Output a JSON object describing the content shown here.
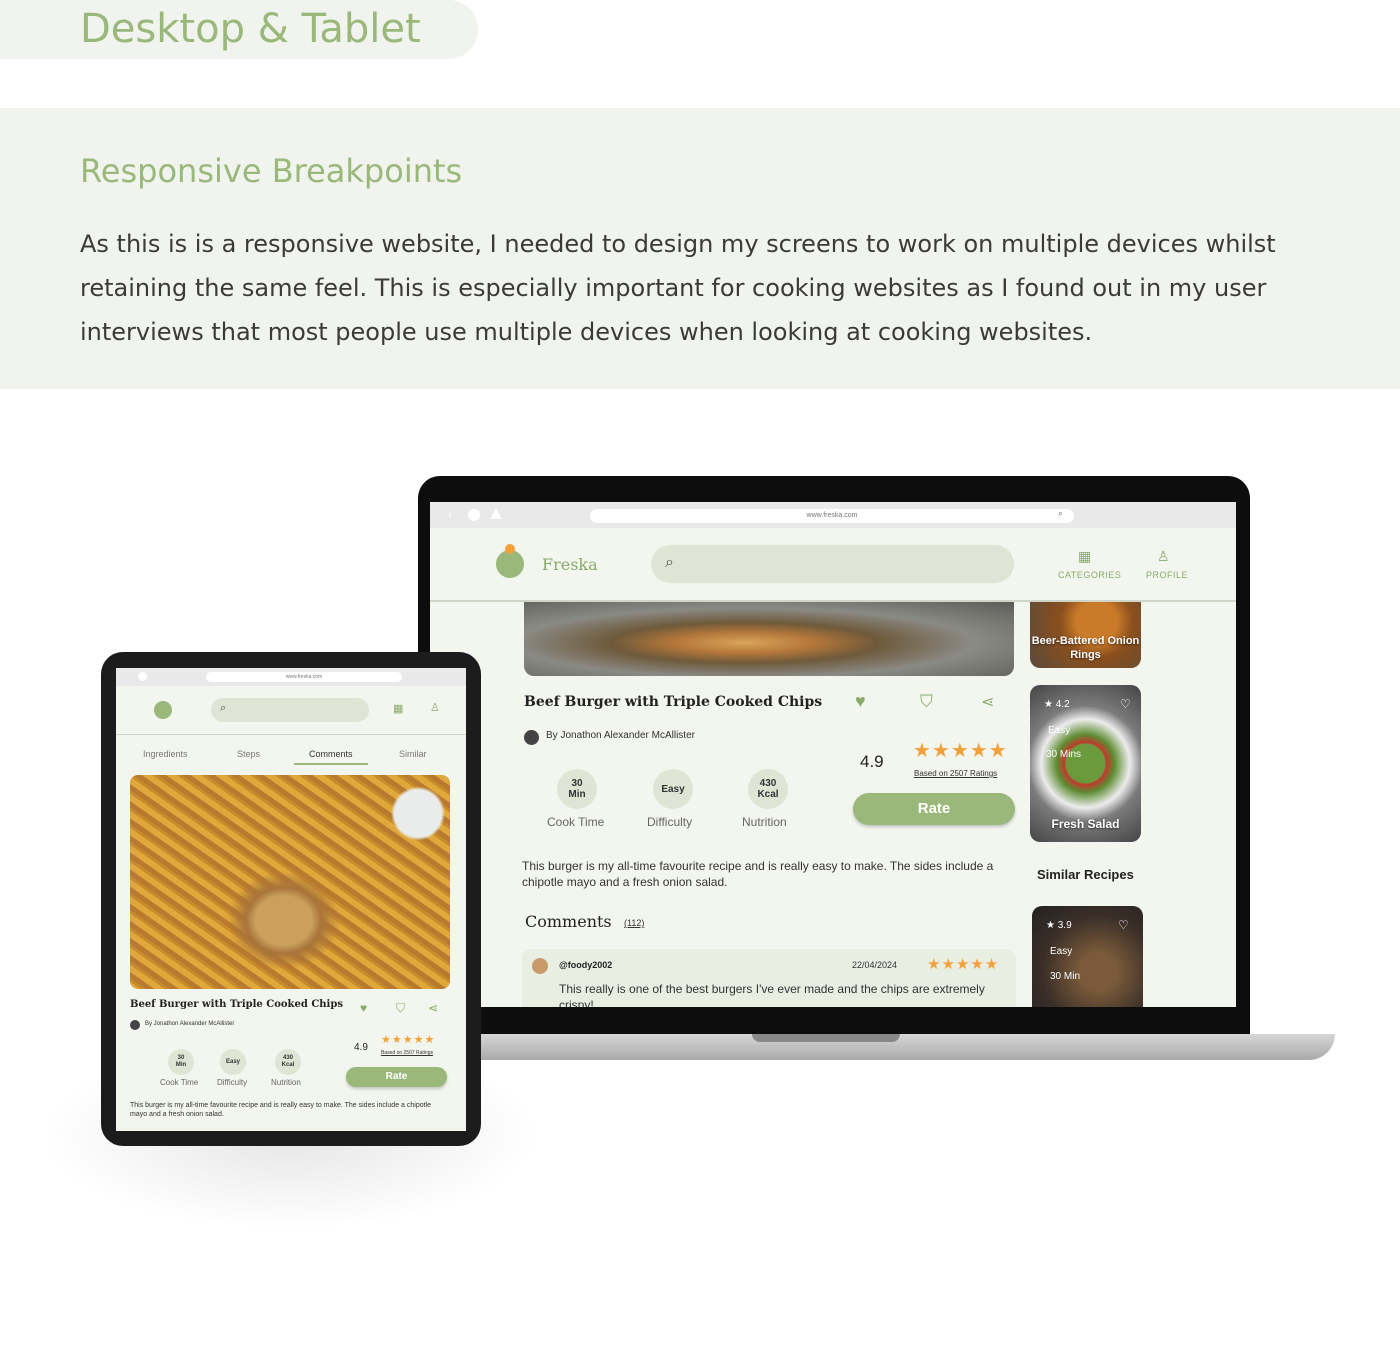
{
  "section_title": "Desktop & Tablet",
  "intro": {
    "heading": "Responsive Breakpoints",
    "body": "As this is is a responsive website, I needed to design my screens to work on multiple devices whilst retaining the same feel. This is especially important for cooking websites as I found out in my user interviews that most people use multiple devices when looking at cooking websites."
  },
  "browser": {
    "url": "www.freska.com"
  },
  "app": {
    "brand": "Freska",
    "nav": {
      "categories": "CATEGORIES",
      "profile": "PROFILE"
    }
  },
  "recipe": {
    "title": "Beef Burger with Triple Cooked Chips",
    "author": "By Jonathon Alexander McAllister",
    "rating": "4.9",
    "stars": "★★★★★",
    "ratings_note": "Based on 2507 Ratings",
    "rate_label": "Rate",
    "stats": [
      {
        "value": "30\nMin",
        "label": "Cook Time"
      },
      {
        "value": "Easy",
        "label": "Difficulty"
      },
      {
        "value": "430\nKcal",
        "label": "Nutrition"
      }
    ],
    "description": "This burger is my all-time favourite recipe and is really easy to make. The sides include a chipotle mayo and a fresh onion salad."
  },
  "comments": {
    "heading": "Comments",
    "count": "(112)",
    "items": [
      {
        "user": "@foody2002",
        "date": "22/04/2024",
        "stars": "★★★★★",
        "text": "This really is one of the best burgers I've ever made and the chips are extremely crispy!"
      }
    ]
  },
  "sidebar": {
    "similar_heading": "Similar Recipes",
    "cards": [
      {
        "name": "Beer-Battered Onion Rings"
      },
      {
        "name": "Fresh Salad",
        "rating": "★ 4.2",
        "difficulty": "Easy",
        "time": "30 Mins"
      },
      {
        "rating": "★ 3.9",
        "difficulty": "Easy",
        "time": "30 Min"
      }
    ]
  },
  "tablet": {
    "tabs": [
      "Ingredients",
      "Steps",
      "Comments",
      "Similar"
    ],
    "active_tab": "Comments"
  },
  "colors": {
    "accent": "#9ab87a",
    "background": "#f1f4ee",
    "star": "#f2a13a"
  }
}
